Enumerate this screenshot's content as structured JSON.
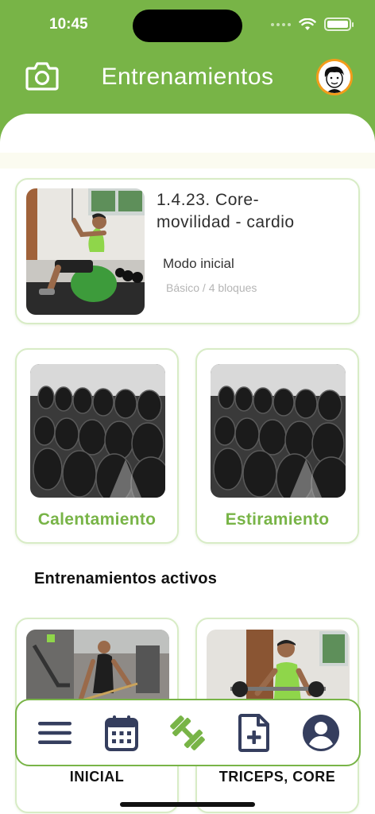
{
  "status_bar": {
    "time": "10:45",
    "battery_level": 1.0
  },
  "header": {
    "title": "Entrenamientos",
    "camera_icon": "camera-icon",
    "avatar_icon": "avatar-cartoon-icon"
  },
  "colors": {
    "brand_green": "#78b447",
    "card_border": "#d8ecc6",
    "nav_dark": "#353e5e",
    "avatar_ring": "#f39c1b"
  },
  "featured": {
    "title": "1.4.23. Core-\nmovilidad - cardio",
    "mode": "Modo inicial",
    "meta": "Básico / 4 bloques"
  },
  "tiles": [
    {
      "label": "Calentamiento"
    },
    {
      "label": "Estiramiento"
    }
  ],
  "active_section": {
    "title": "Entrenamientos activos",
    "cards": [
      {
        "label": "INICIAL"
      },
      {
        "label": "TRICEPS, CORE"
      }
    ]
  },
  "bottom_nav": [
    {
      "icon": "menu-icon",
      "active": false
    },
    {
      "icon": "calendar-icon",
      "active": false
    },
    {
      "icon": "dumbbell-icon",
      "active": true
    },
    {
      "icon": "add-document-icon",
      "active": false
    },
    {
      "icon": "user-icon",
      "active": false
    }
  ]
}
